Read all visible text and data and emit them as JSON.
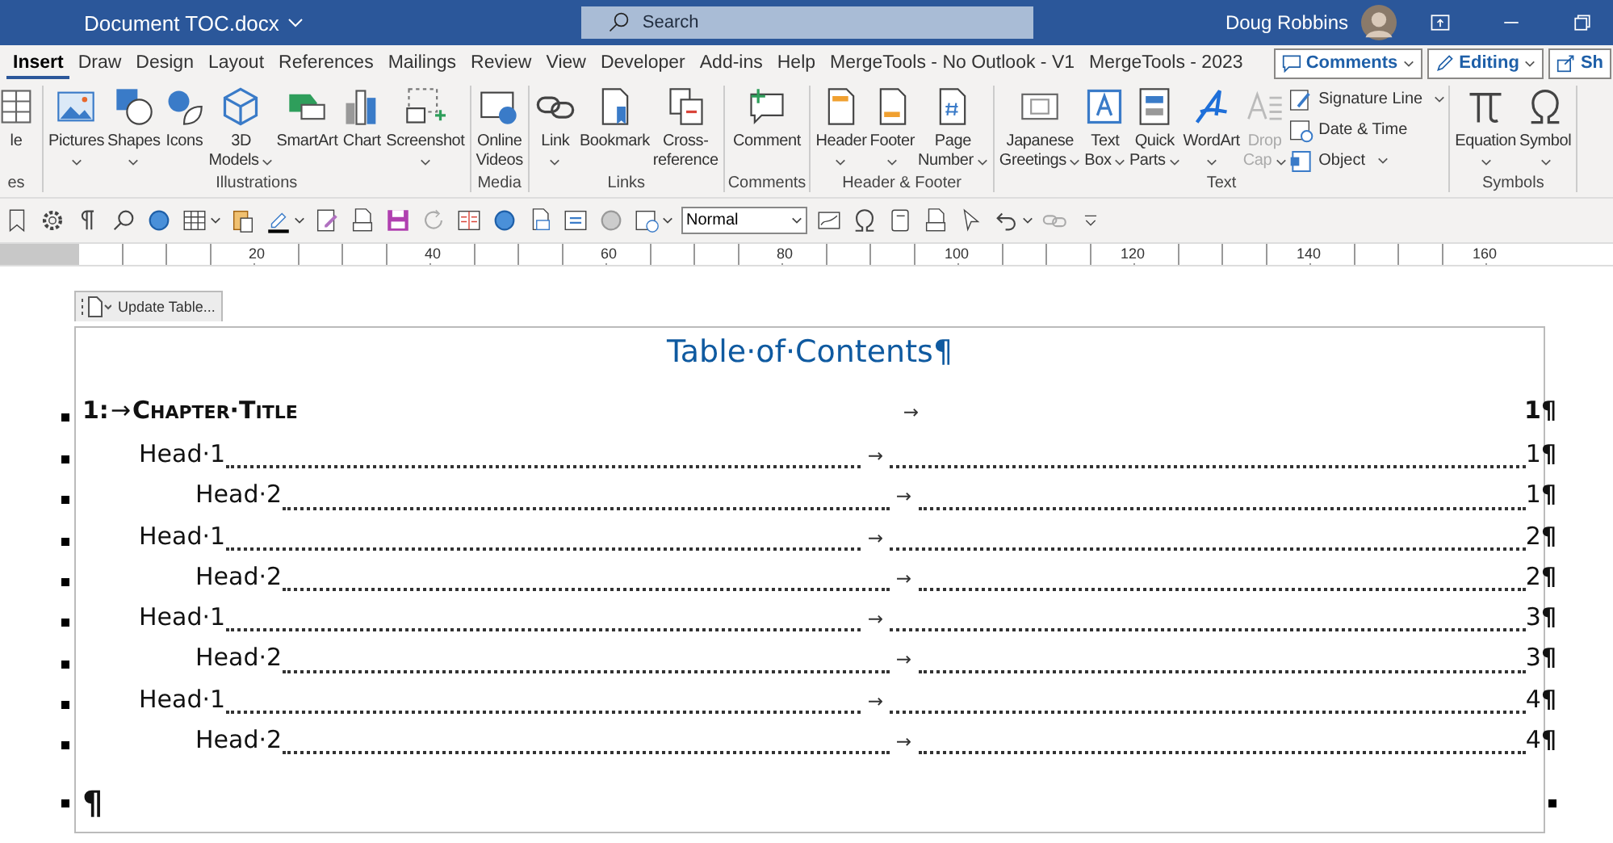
{
  "title_bar": {
    "document": "Document TOC.docx",
    "search": {
      "placeholder": "Search"
    },
    "user": "Doug Robbins"
  },
  "tabs": [
    {
      "label": "Insert",
      "selected": true
    },
    {
      "label": "Draw",
      "selected": false
    },
    {
      "label": "Design",
      "selected": false
    },
    {
      "label": "Layout",
      "selected": false
    },
    {
      "label": "References",
      "selected": false
    },
    {
      "label": "Mailings",
      "selected": false
    },
    {
      "label": "Review",
      "selected": false
    },
    {
      "label": "View",
      "selected": false
    },
    {
      "label": "Developer",
      "selected": false
    },
    {
      "label": "Add-ins",
      "selected": false
    },
    {
      "label": "Help",
      "selected": false
    },
    {
      "label": "MergeTools - No Outlook - V1",
      "selected": false
    },
    {
      "label": "MergeTools - 2023",
      "selected": false
    }
  ],
  "header_buttons": [
    {
      "label": "Comments"
    },
    {
      "label": "Editing"
    },
    {
      "label": "Sh"
    }
  ],
  "ribbon": {
    "groups": [
      {
        "label": "es",
        "buttons": [
          {
            "kind": "large",
            "lines": [
              "le"
            ],
            "caret": false,
            "disabled": false
          }
        ]
      },
      {
        "label": "Illustrations",
        "buttons": [
          {
            "kind": "large",
            "lines": [
              "Pictures"
            ],
            "caret": true,
            "disabled": false
          },
          {
            "kind": "large",
            "lines": [
              "Shapes"
            ],
            "caret": true,
            "disabled": false
          },
          {
            "kind": "large",
            "lines": [
              "Icons"
            ],
            "caret": false,
            "disabled": false
          },
          {
            "kind": "large",
            "lines": [
              "3D",
              "Models"
            ],
            "caret": true,
            "disabled": false
          },
          {
            "kind": "large",
            "lines": [
              "SmartArt"
            ],
            "caret": false,
            "disabled": false
          },
          {
            "kind": "large",
            "lines": [
              "Chart"
            ],
            "caret": false,
            "disabled": false
          },
          {
            "kind": "large",
            "lines": [
              "Screenshot"
            ],
            "caret": true,
            "disabled": false
          }
        ]
      },
      {
        "label": "Media",
        "buttons": [
          {
            "kind": "large",
            "lines": [
              "Online",
              "Videos"
            ],
            "caret": false,
            "disabled": false
          }
        ]
      },
      {
        "label": "Links",
        "buttons": [
          {
            "kind": "large",
            "lines": [
              "Link"
            ],
            "caret": true,
            "disabled": false
          },
          {
            "kind": "large",
            "lines": [
              "Bookmark"
            ],
            "caret": false,
            "disabled": false
          },
          {
            "kind": "large",
            "lines": [
              "Cross-",
              "reference"
            ],
            "caret": false,
            "disabled": false
          }
        ]
      },
      {
        "label": "Comments",
        "buttons": [
          {
            "kind": "large",
            "lines": [
              "Comment"
            ],
            "caret": false,
            "disabled": false
          }
        ]
      },
      {
        "label": "Header & Footer",
        "buttons": [
          {
            "kind": "large",
            "lines": [
              "Header"
            ],
            "caret": true,
            "disabled": false
          },
          {
            "kind": "large",
            "lines": [
              "Footer"
            ],
            "caret": true,
            "disabled": false
          },
          {
            "kind": "large",
            "lines": [
              "Page",
              "Number"
            ],
            "caret": true,
            "disabled": false
          }
        ]
      },
      {
        "label": "Text",
        "buttons": [
          {
            "kind": "large",
            "lines": [
              "Japanese",
              "Greetings"
            ],
            "caret": true,
            "disabled": false
          },
          {
            "kind": "large",
            "lines": [
              "Text",
              "Box"
            ],
            "caret": true,
            "disabled": false
          },
          {
            "kind": "large",
            "lines": [
              "Quick",
              "Parts"
            ],
            "caret": true,
            "disabled": false
          },
          {
            "kind": "large",
            "lines": [
              "WordArt"
            ],
            "caret": true,
            "disabled": false
          },
          {
            "kind": "large",
            "lines": [
              "Drop",
              "Cap"
            ],
            "caret": true,
            "disabled": true
          },
          {
            "kind": "small",
            "lines": [
              "Signature Line"
            ],
            "caret": true,
            "disabled": false
          },
          {
            "kind": "small",
            "lines": [
              "Date & Time"
            ],
            "caret": false,
            "disabled": false
          },
          {
            "kind": "small",
            "lines": [
              "Object"
            ],
            "caret": true,
            "disabled": false
          }
        ]
      },
      {
        "label": "Symbols",
        "buttons": [
          {
            "kind": "large",
            "lines": [
              "Equation"
            ],
            "caret": true,
            "disabled": false
          },
          {
            "kind": "large",
            "lines": [
              "Symbol"
            ],
            "caret": true,
            "disabled": false
          }
        ]
      }
    ]
  },
  "quick_toolbar": {
    "style_box": "Normal"
  },
  "ruler": {
    "numbers": [
      "20",
      "40",
      "60",
      "80",
      "100",
      "120",
      "140",
      "160"
    ]
  },
  "document": {
    "content_control": {
      "tab": "Update Table..."
    },
    "title": "Table·of·Contents¶",
    "entries": [
      {
        "kind": "chapter",
        "number": "1:",
        "arrow": "→",
        "text": "Chapter·Title",
        "tab": "→",
        "page": "1¶"
      },
      {
        "kind": "head1",
        "text": "Head·1",
        "tab": "→",
        "page": "1**¶**"
      },
      {
        "kind": "head2",
        "text": "Head·2",
        "tab": "→",
        "page": "1**¶**"
      },
      {
        "kind": "head1",
        "text": "Head·1",
        "tab": "→",
        "page": "2**¶**"
      },
      {
        "kind": "head2",
        "text": "Head·2",
        "tab": "→",
        "page": "2**¶**"
      },
      {
        "kind": "head1",
        "text": "Head·1",
        "tab": "→",
        "page": "3**¶**"
      },
      {
        "kind": "head2",
        "text": "Head·2",
        "tab": "→",
        "page": "3**¶**"
      },
      {
        "kind": "head1",
        "text": "Head·1",
        "tab": "→",
        "page": "4**¶**"
      },
      {
        "kind": "head2",
        "text": "Head·2",
        "tab": "→",
        "page": "4**¶**"
      }
    ],
    "end_mark": "¶"
  }
}
